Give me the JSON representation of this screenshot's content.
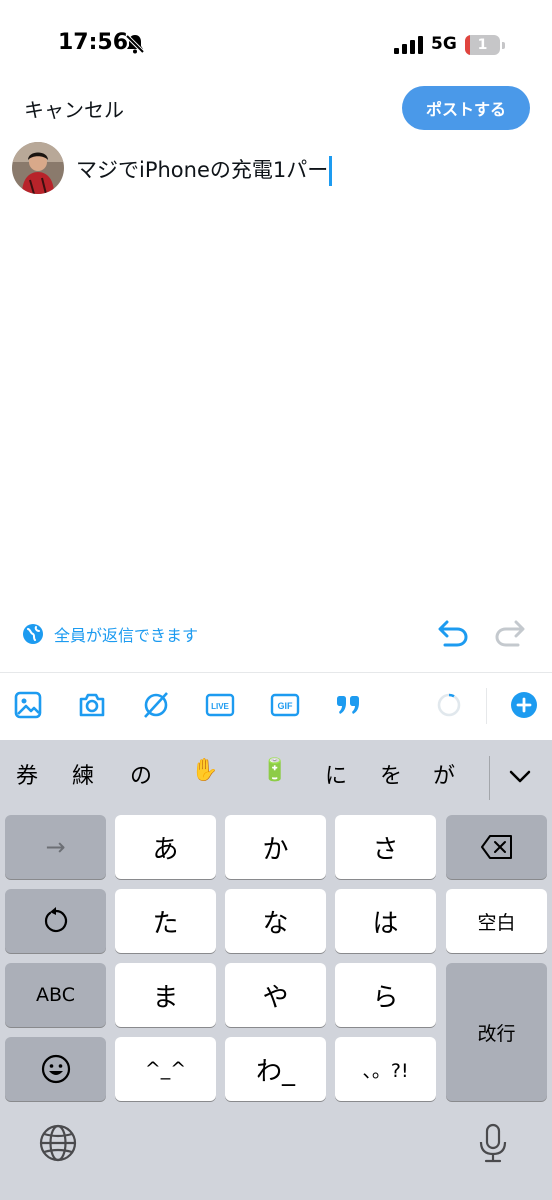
{
  "status_bar": {
    "time": "17:56",
    "network": "5G",
    "battery_level": "1"
  },
  "compose": {
    "cancel_label": "キャンセル",
    "post_label": "ポストする",
    "text": "マジでiPhoneの充電1パー"
  },
  "reply_setting": {
    "label": "全員が返信できます"
  },
  "toolbar": {
    "icons": [
      "image-icon",
      "camera-icon",
      "grok-icon",
      "live-icon",
      "gif-icon",
      "quote-icon",
      "char-count-circle-icon",
      "add-thread-icon"
    ],
    "live_label": "LIVE",
    "gif_label": "GIF"
  },
  "keyboard": {
    "candidates": [
      "券",
      "練",
      "の",
      "✋",
      "🔋",
      "に",
      "を",
      "が"
    ],
    "keys": {
      "arrow": "→",
      "a": "あ",
      "ka": "か",
      "sa": "さ",
      "undo": "↺",
      "ta": "た",
      "na": "な",
      "ha": "は",
      "space": "空白",
      "abc": "ABC",
      "ma": "ま",
      "ya": "や",
      "ra": "ら",
      "return": "改行",
      "emoji": "☺",
      "kaomoji": "^_^",
      "wa": "わ_",
      "punct": "、。?!"
    }
  },
  "colors": {
    "accent": "#1d9bf0",
    "post_button": "#4a99e9",
    "battery_low": "#e0443e",
    "keyboard_bg": "#d1d4db"
  }
}
